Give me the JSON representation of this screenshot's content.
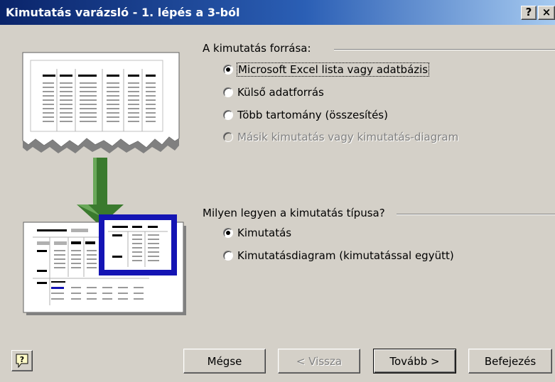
{
  "window": {
    "title": "Kimutatás varázsló - 1. lépés a 3-ból",
    "help_glyph": "?",
    "close_glyph": "×"
  },
  "source_group": {
    "label": "A kimutatás forrása:",
    "options": [
      {
        "label": "Microsoft Excel lista vagy adatbázis",
        "checked": true,
        "enabled": true
      },
      {
        "label": "Külső adatforrás",
        "checked": false,
        "enabled": true
      },
      {
        "label": "Több tartomány (összesítés)",
        "checked": false,
        "enabled": true
      },
      {
        "label": "Másik kimutatás vagy kimutatás-diagram",
        "checked": false,
        "enabled": false
      }
    ]
  },
  "type_group": {
    "label": "Milyen legyen a kimutatás típusa?",
    "options": [
      {
        "label": "Kimutatás",
        "checked": true,
        "enabled": true
      },
      {
        "label": "Kimutatásdiagram (kimutatással együtt)",
        "checked": false,
        "enabled": true
      }
    ]
  },
  "buttons": {
    "help_icon_glyph": "?",
    "cancel": "Mégse",
    "back": "< Vissza",
    "next": "Tovább >",
    "finish": "Befejezés"
  },
  "colors": {
    "dialog_bg": "#d4d0c8",
    "title_start": "#0a246a",
    "title_end": "#a6caf0",
    "arrow_green": "#3a7a2e",
    "pivot_blue": "#1414b4"
  }
}
